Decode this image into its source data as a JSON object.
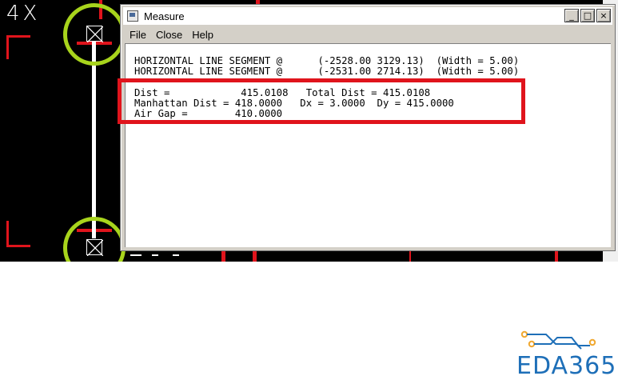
{
  "cad": {
    "label_glyphs": "4X",
    "colors": {
      "background": "#000000",
      "trace": "#e0141c",
      "measure_line": "#ffffff",
      "marker_ring": "#a8d41c"
    }
  },
  "dialog": {
    "title": "Measure",
    "window_buttons": {
      "minimize": "_",
      "maximize": "□",
      "close": "×"
    },
    "menu": [
      "File",
      "Close",
      "Help"
    ],
    "lines": [
      "HORIZONTAL LINE SEGMENT @      (-2528.00 3129.13)  (Width = 5.00)",
      "HORIZONTAL LINE SEGMENT @      (-2531.00 2714.13)  (Width = 5.00)",
      "",
      "Dist =            415.0108   Total Dist = 415.0108",
      "Manhattan Dist = 418.0000   Dx = 3.0000  Dy = 415.0000",
      "Air Gap =        410.0000"
    ],
    "highlight_color": "#e0141c"
  },
  "logo": {
    "text": "EDA365",
    "color": "#1e6fb8",
    "accent": "#f0a830"
  }
}
